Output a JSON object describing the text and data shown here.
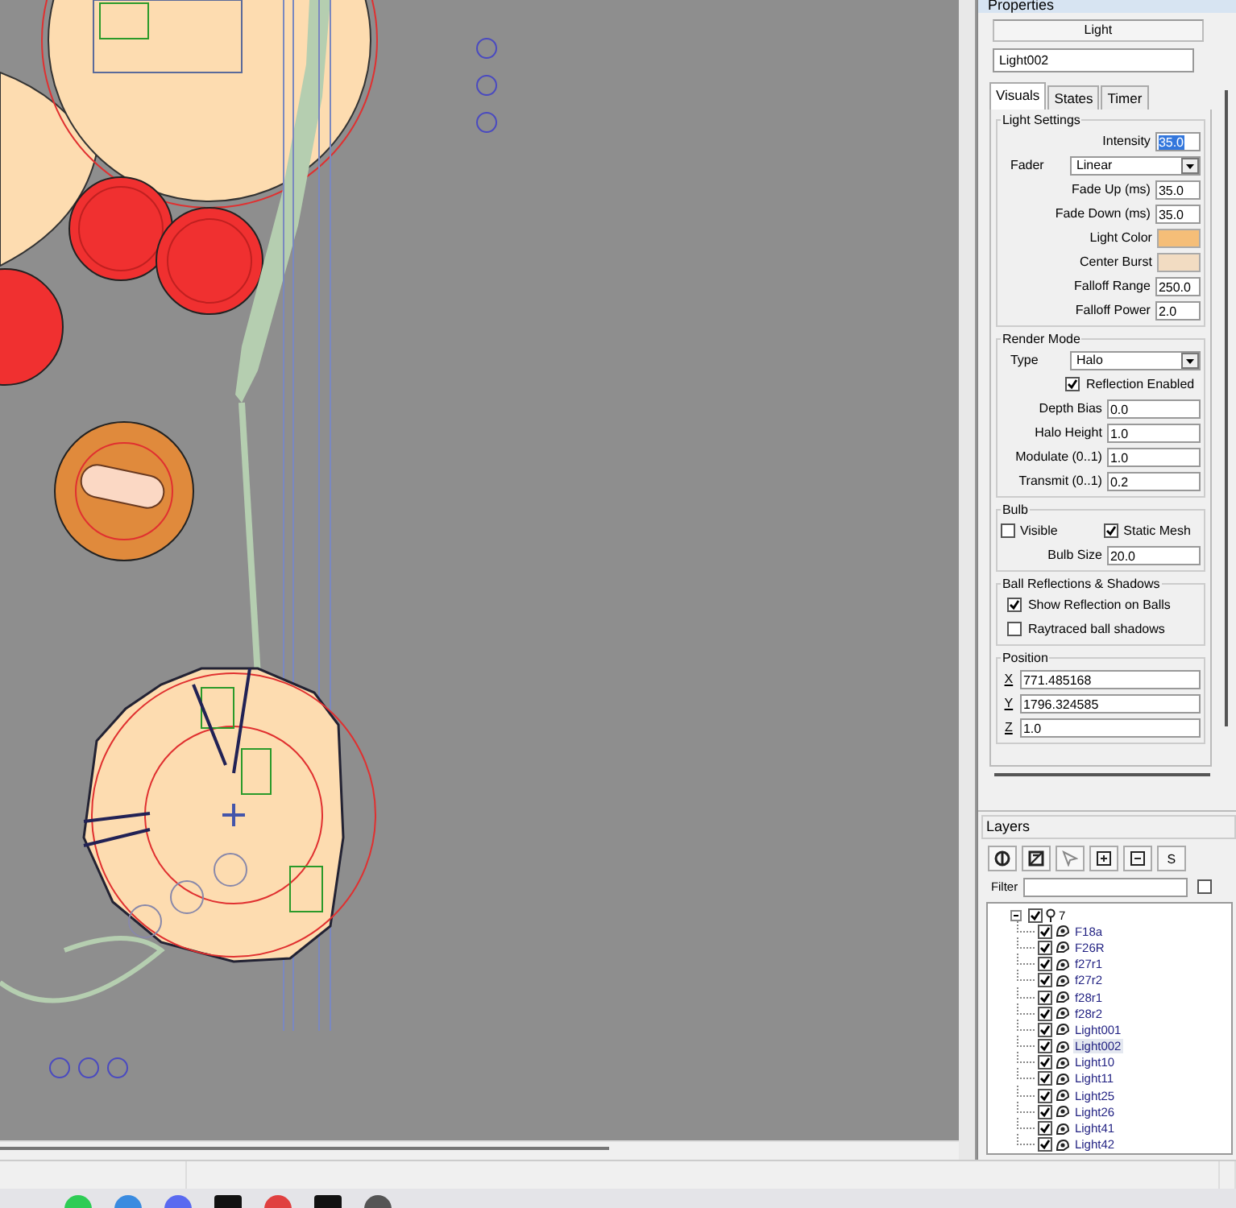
{
  "properties": {
    "title": "Properties",
    "object_type": "Light",
    "name": "Light002",
    "tabs": [
      {
        "label": "Visuals",
        "selected": true
      },
      {
        "label": "States",
        "selected": false
      },
      {
        "label": "Timer",
        "selected": false
      }
    ],
    "groups": [
      {
        "title": "Light Settings",
        "rows": [
          {
            "kind": "field",
            "label": "Intensity",
            "value": "35.0",
            "text_selected": true
          },
          {
            "kind": "select",
            "label": "Fader",
            "value": "Linear"
          },
          {
            "kind": "field",
            "label": "Fade Up (ms)",
            "value": "35.0",
            "text_selected": false
          },
          {
            "kind": "field",
            "label": "Fade Down (ms)",
            "value": "35.0",
            "text_selected": false
          },
          {
            "kind": "color",
            "label": "Light Color",
            "color": "#f5be78"
          },
          {
            "kind": "color",
            "label": "Center Burst",
            "color": "#f2dcc2"
          },
          {
            "kind": "field",
            "label": "Falloff Range",
            "value": "250.0",
            "text_selected": false
          },
          {
            "kind": "field",
            "label": "Falloff Power",
            "value": "2.0",
            "text_selected": false
          }
        ]
      },
      {
        "title": "Render Mode",
        "rows": [
          {
            "kind": "select",
            "label": "Type",
            "value": "Halo"
          },
          {
            "kind": "check",
            "label": "Reflection Enabled",
            "checked": true
          },
          {
            "kind": "wide",
            "label": "Depth Bias",
            "value": "0.0"
          },
          {
            "kind": "wide",
            "label": "Halo Height",
            "value": "1.0"
          },
          {
            "kind": "wide",
            "label": "Modulate (0..1)",
            "value": "1.0"
          },
          {
            "kind": "wide",
            "label": "Transmit (0..1)",
            "value": "0.2"
          }
        ]
      },
      {
        "title": "Bulb",
        "rows": [
          {
            "kind": "checks",
            "items": [
              {
                "label": "Visible",
                "checked": false
              },
              {
                "label": "Static Mesh",
                "checked": true
              }
            ]
          },
          {
            "kind": "wide",
            "label": "Bulb Size",
            "value": "20.0"
          }
        ]
      },
      {
        "title": "Ball Reflections & Shadows",
        "rows": [
          {
            "kind": "check",
            "label": "Show Reflection on Balls",
            "checked": true
          },
          {
            "kind": "check",
            "label": "Raytraced ball shadows",
            "checked": false
          }
        ]
      },
      {
        "title": "Position",
        "rows": [
          {
            "kind": "axis",
            "label": "X",
            "value": "771.485168"
          },
          {
            "kind": "axis",
            "label": "Y",
            "value": "1796.324585"
          },
          {
            "kind": "axis",
            "label": "Z",
            "value": "1.0"
          }
        ]
      }
    ]
  },
  "layers": {
    "title": "Layers",
    "toolbar_text_button": "S",
    "filter_label": "Filter",
    "filter_checked": false,
    "tree": [
      {
        "label": "7",
        "checked": true,
        "expanded": true,
        "children": [
          {
            "label": "F18a",
            "checked": true,
            "selected": false
          },
          {
            "label": "F26R",
            "checked": true,
            "selected": false
          },
          {
            "label": "f27r1",
            "checked": true,
            "selected": false
          },
          {
            "label": "f27r2",
            "checked": true,
            "selected": false
          },
          {
            "label": "f28r1",
            "checked": true,
            "selected": false
          },
          {
            "label": "f28r2",
            "checked": true,
            "selected": false
          },
          {
            "label": "Light001",
            "checked": true,
            "selected": false
          },
          {
            "label": "Light002",
            "checked": true,
            "selected": true
          },
          {
            "label": "Light10",
            "checked": true,
            "selected": false
          },
          {
            "label": "Light11",
            "checked": true,
            "selected": false
          },
          {
            "label": "Light25",
            "checked": true,
            "selected": false
          },
          {
            "label": "Light26",
            "checked": true,
            "selected": false
          },
          {
            "label": "Light41",
            "checked": true,
            "selected": false
          },
          {
            "label": "Light42",
            "checked": true,
            "selected": false
          }
        ]
      }
    ]
  }
}
